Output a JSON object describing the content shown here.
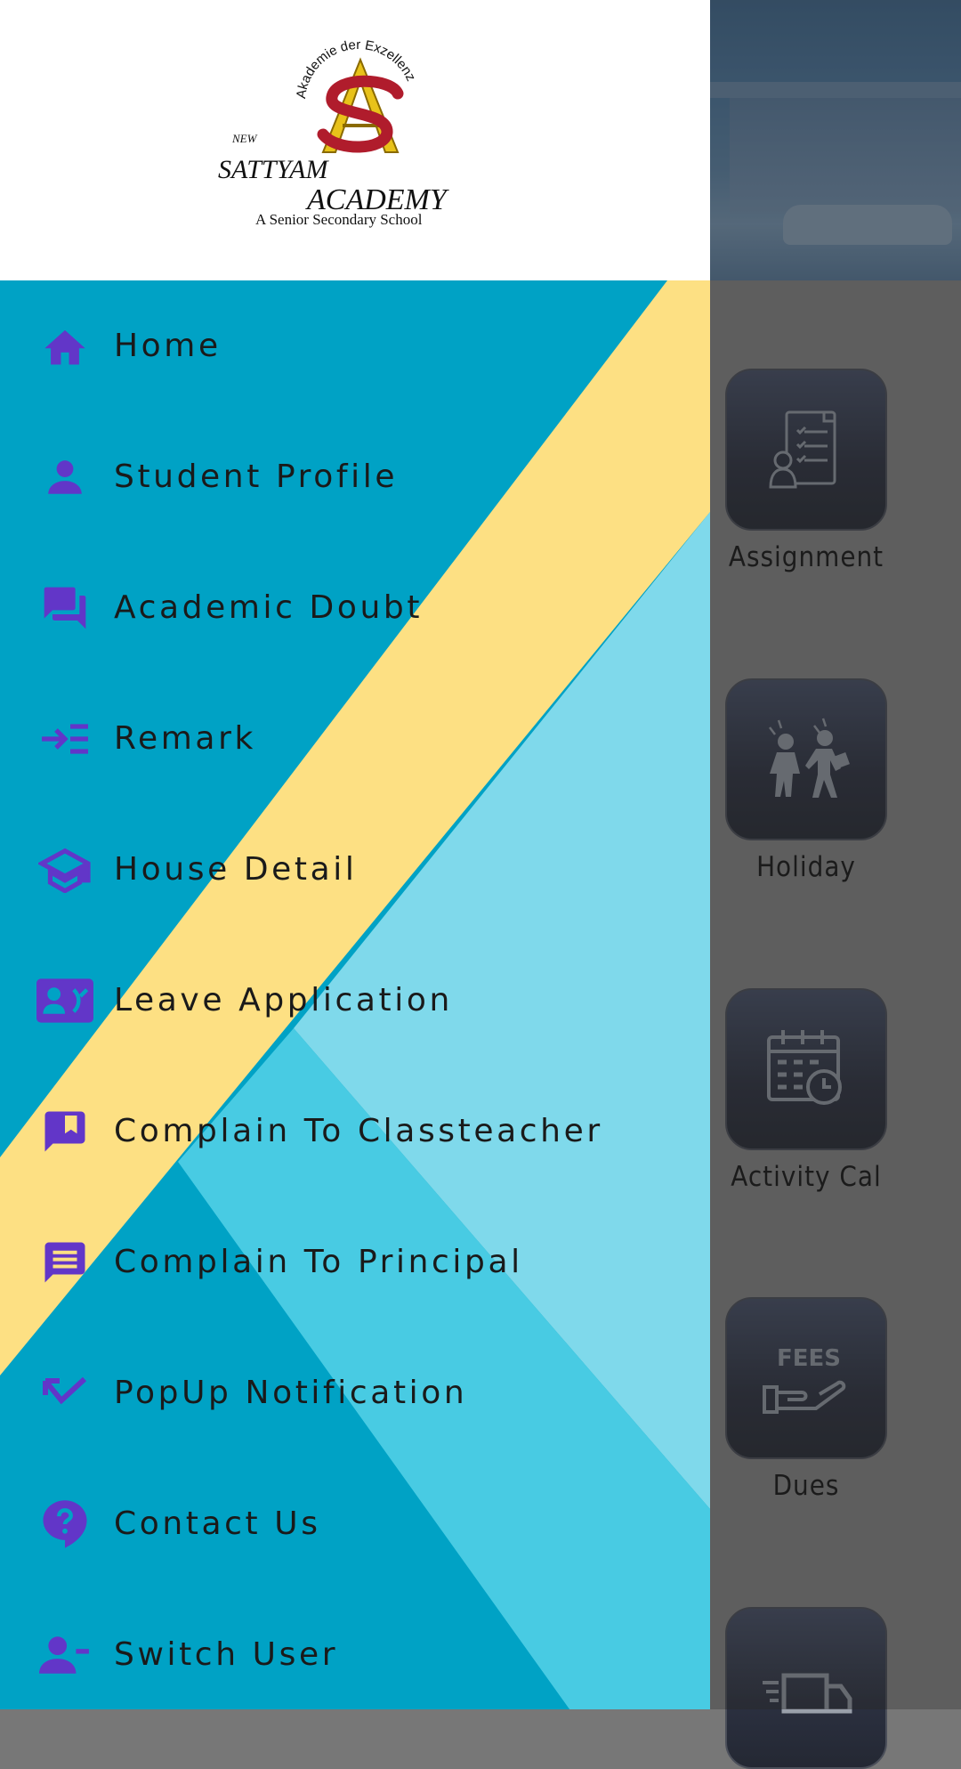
{
  "school": {
    "logo_alt": "New Sattyam Academy logo",
    "motto": "Akademie der Exzellenz",
    "name_prefix": "NEW",
    "name_line1": "SATTYAM",
    "name_line2": "ACADEMY",
    "tagline": "A Senior Secondary School"
  },
  "menu": {
    "items": [
      {
        "label": "Home",
        "icon": "home-icon"
      },
      {
        "label": "Student Profile",
        "icon": "person-icon"
      },
      {
        "label": "Academic Doubt",
        "icon": "forum-icon"
      },
      {
        "label": "Remark",
        "icon": "arrow-list-icon"
      },
      {
        "label": "House Detail",
        "icon": "school-cap-icon"
      },
      {
        "label": "Leave Application",
        "icon": "contact-phone-icon"
      },
      {
        "label": "Complain To Classteacher",
        "icon": "bookmark-chat-icon"
      },
      {
        "label": "Complain To Principal",
        "icon": "chat-lines-icon"
      },
      {
        "label": "PopUp Notification",
        "icon": "callmade-icon"
      },
      {
        "label": "Contact Us",
        "icon": "help-bubble-icon"
      },
      {
        "label": "Switch User",
        "icon": "person-remove-icon"
      }
    ]
  },
  "dashboard": {
    "tiles": [
      {
        "label": "Assignment",
        "icon": "assignment-icon"
      },
      {
        "label": "Holiday",
        "icon": "holiday-icon"
      },
      {
        "label": "Activity Cal",
        "icon": "calendar-icon"
      },
      {
        "label": "Dues",
        "icon": "fees-icon",
        "icon_text": "FEES"
      },
      {
        "label": "",
        "icon": "delivery-truck-icon"
      }
    ]
  },
  "colors": {
    "icon_purple": "#6236c8",
    "drawer_teal": "#00a2c5",
    "drawer_yellow": "#fde083",
    "drawer_lightblue": "#7fd9eb"
  }
}
